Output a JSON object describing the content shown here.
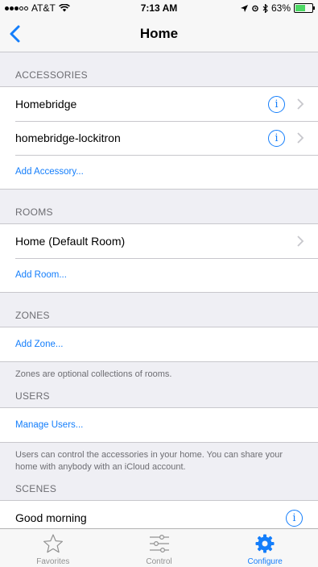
{
  "status": {
    "carrier": "AT&T",
    "time": "7:13 AM",
    "battery": "63%",
    "battery_level": 0.63
  },
  "nav": {
    "title": "Home"
  },
  "accessories": {
    "header": "ACCESSORIES",
    "items": [
      "Homebridge",
      "homebridge-lockitron"
    ],
    "add_label": "Add Accessory..."
  },
  "rooms": {
    "header": "ROOMS",
    "items": [
      "Home (Default Room)"
    ],
    "add_label": "Add Room..."
  },
  "zones": {
    "header": "ZONES",
    "add_label": "Add Zone...",
    "footer": "Zones are optional collections of rooms."
  },
  "users": {
    "header": "USERS",
    "manage_label": "Manage Users...",
    "footer": "Users can control the accessories in your home. You can share your home with anybody with an iCloud account."
  },
  "scenes": {
    "header": "SCENES",
    "items": [
      "Good morning"
    ]
  },
  "tabs": [
    {
      "label": "Favorites",
      "icon": "star-icon"
    },
    {
      "label": "Control",
      "icon": "sliders-icon"
    },
    {
      "label": "Configure",
      "icon": "gear-icon",
      "active": true
    }
  ],
  "colors": {
    "accent": "#147efb",
    "background": "#efeff4",
    "secondary_text": "#6d6d72"
  }
}
